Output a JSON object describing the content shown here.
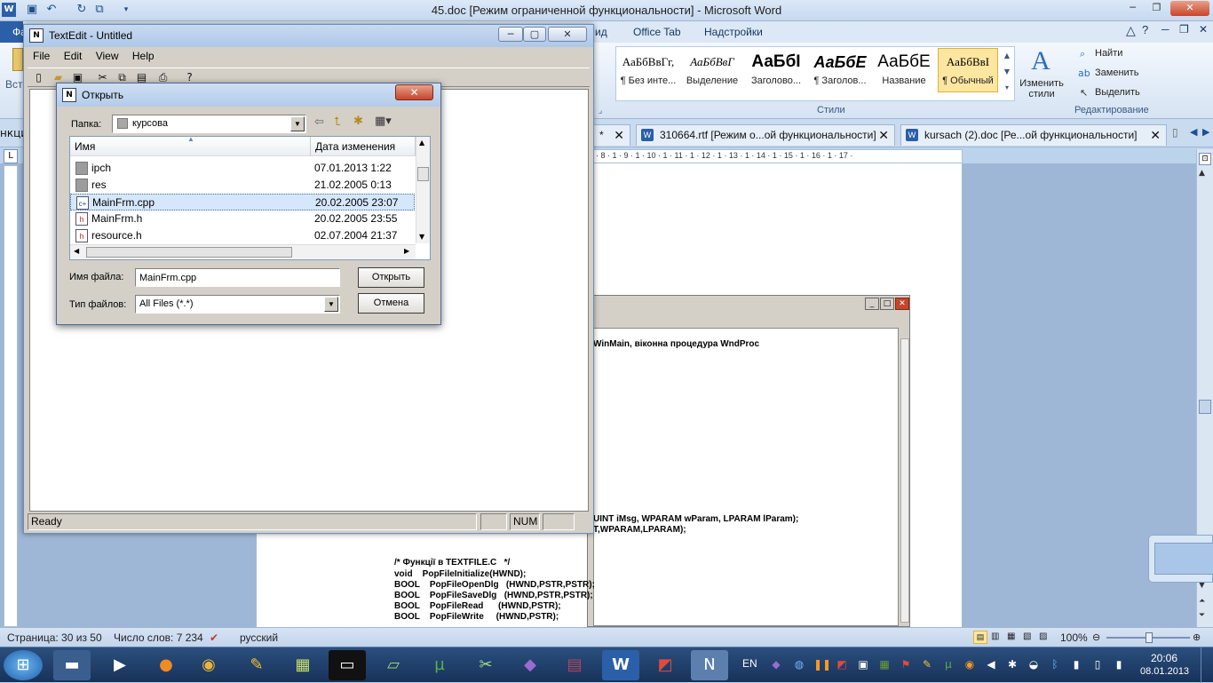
{
  "word": {
    "title": "45.doc [Режим ограниченной функциональности]  -  Microsoft Word",
    "tabs": {
      "view_partial": "ид",
      "office_tab": "Office Tab",
      "addins": "Надстройки"
    },
    "styles": [
      {
        "sample": "АаБбВвГг,",
        "caption": "¶ Без инте..."
      },
      {
        "sample": "АаБбВвГ",
        "caption": "Выделение"
      },
      {
        "sample": "АаБбІ",
        "caption": "Заголово..."
      },
      {
        "sample": "АаБбЕ",
        "caption": "¶ Заголов..."
      },
      {
        "sample": "АаБбЕ",
        "caption": "Название"
      },
      {
        "sample": "АаБбВвІ",
        "caption": "¶ Обычный"
      }
    ],
    "change_styles": "Изменить стили",
    "styles_group": "Стили",
    "editing": {
      "find": "Найти",
      "replace": "Заменить",
      "select": "Выделить",
      "group": "Редактирование"
    },
    "left_partial_tab": "Фа",
    "left_partial_label": "Вста",
    "left_partial_doctab": "нкционально",
    "doc_tabs": [
      {
        "label": "*"
      },
      {
        "label": "310664.rtf [Режим о...ой функциональности]"
      },
      {
        "label": "kursach (2).doc [Ре...ой функциональности]"
      }
    ],
    "ruler_marks": "· 8 · 1 · 9 · 1 · 10 · 1 · 11 · 1 · 12 · 1 · 13 · 1 · 14 · 1 · 15 · 1 · 16 · 1 · 17 ·",
    "code_lines": [
      "WinMain, віконна процедура WndProc",
      "UINT iMsg, WPARAM wParam, LPARAM lParam);",
      "T,WPARAM,LPARAM);",
      "/* Функції в TEXTFILE.C   */",
      "void    PopFileInitialize(HWND);",
      "BOOL    PopFileOpenDlg   (HWND,PSTR,PSTR);",
      "BOOL    PopFileSaveDlg   (HWND,PSTR,PSTR);",
      "BOOL    PopFileRead      (HWND,PSTR);",
      "BOOL    PopFileWrite     (HWND,PSTR);"
    ],
    "status": {
      "page": "Страница: 30 из 50",
      "words": "Число слов: 7 234",
      "lang": "русский",
      "zoom": "100%"
    }
  },
  "textedit": {
    "title": "TextEdit - Untitled",
    "menu": [
      "File",
      "Edit",
      "View",
      "Help"
    ],
    "status_ready": "Ready",
    "status_num": "NUM"
  },
  "dialog": {
    "title": "Открыть",
    "folder_label": "Папка:",
    "folder_value": "курсова",
    "col_name": "Имя",
    "col_date": "Дата изменения",
    "files": [
      {
        "name": "ipch",
        "date": "07.01.2013 1:22",
        "type": "folder"
      },
      {
        "name": "res",
        "date": "21.02.2005 0:13",
        "type": "folder"
      },
      {
        "name": "MainFrm.cpp",
        "date": "20.02.2005 23:07",
        "type": "cpp",
        "selected": true
      },
      {
        "name": "MainFrm.h",
        "date": "20.02.2005 23:55",
        "type": "h"
      },
      {
        "name": "resource.h",
        "date": "02.07.2004 21:37",
        "type": "h"
      }
    ],
    "filename_label": "Имя файла:",
    "filename_value": "MainFrm.cpp",
    "filetype_label": "Тип файлов:",
    "filetype_value": "All Files (*.*)",
    "open_button": "Открыть",
    "cancel_button": "Отмена"
  },
  "taskbar": {
    "lang": "EN",
    "time": "20:06",
    "date": "08.01.2013"
  },
  "colors": {
    "taskbar": "#1f3b66",
    "ribbon": "#dce8f6",
    "selection": "#d6e7fb"
  }
}
